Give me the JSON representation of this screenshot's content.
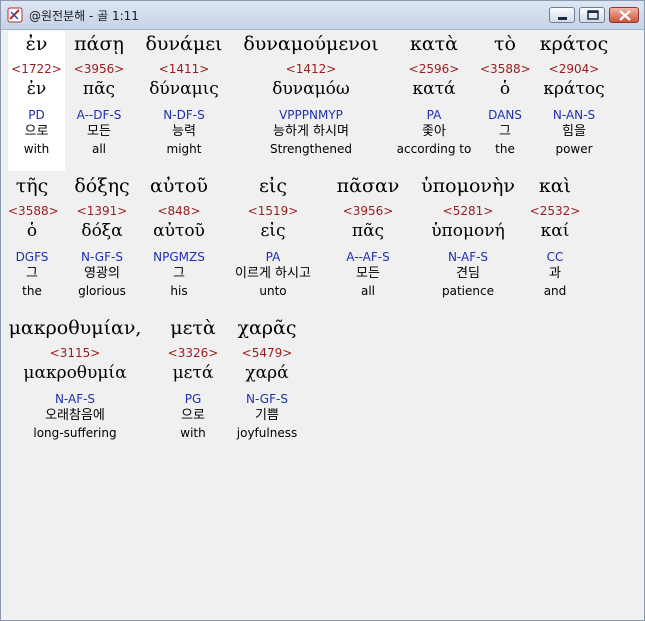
{
  "window": {
    "title": "@원전분해 - 골 1:11"
  },
  "rows": [
    [
      {
        "greek": "ἐν",
        "strong": "<1722>",
        "lemma": "ἐν",
        "morph": "PD",
        "korean": "으로",
        "english": "with"
      },
      {
        "greek": "πάσῃ",
        "strong": "<3956>",
        "lemma": "πᾶς",
        "morph": "A--DF-S",
        "korean": "모든",
        "english": "all"
      },
      {
        "greek": "δυνάμει",
        "strong": "<1411>",
        "lemma": "δύναμις",
        "morph": "N-DF-S",
        "korean": "능력",
        "english": "might"
      },
      {
        "greek": "δυναμούμενοι",
        "strong": "<1412>",
        "lemma": "δυναμόω",
        "morph": "VPPPNMYP",
        "korean": "능하게 하시며",
        "english": "Strengthened"
      },
      {
        "greek": "κατὰ",
        "strong": "<2596>",
        "lemma": "κατά",
        "morph": "PA",
        "korean": "좇아",
        "english": "according to"
      },
      {
        "greek": "τὸ",
        "strong": "<3588>",
        "lemma": "ὁ",
        "morph": "DANS",
        "korean": "그",
        "english": "the"
      },
      {
        "greek": "κράτος",
        "strong": "<2904>",
        "lemma": "κράτος",
        "morph": "N-AN-S",
        "korean": "힘을",
        "english": "power"
      }
    ],
    [
      {
        "greek": "τῆς",
        "strong": "<3588>",
        "lemma": "ὁ",
        "morph": "DGFS",
        "korean": "그",
        "english": "the"
      },
      {
        "greek": "δόξης",
        "strong": "<1391>",
        "lemma": "δόξα",
        "morph": "N-GF-S",
        "korean": "영광의",
        "english": "glorious"
      },
      {
        "greek": "αὐτοῦ",
        "strong": "<848>",
        "lemma": "αὐτοῦ",
        "morph": "NPGMZS",
        "korean": "그",
        "english": "his"
      },
      {
        "greek": "εἰς",
        "strong": "<1519>",
        "lemma": "εἰς",
        "morph": "PA",
        "korean": "이르게 하시고",
        "english": "unto"
      },
      {
        "greek": "πᾶσαν",
        "strong": "<3956>",
        "lemma": "πᾶς",
        "morph": "A--AF-S",
        "korean": "모든",
        "english": "all"
      },
      {
        "greek": "ὑπομονὴν",
        "strong": "<5281>",
        "lemma": "ὑπομονή",
        "morph": "N-AF-S",
        "korean": "견딤",
        "english": "patience"
      },
      {
        "greek": "καὶ",
        "strong": "<2532>",
        "lemma": "καί",
        "morph": "CC",
        "korean": "과",
        "english": "and"
      }
    ],
    [
      {
        "greek": "μακροθυμίαν,",
        "strong": "<3115>",
        "lemma": "μακροθυμία",
        "morph": "N-AF-S",
        "korean": "오래참음에",
        "english": "long-suffering"
      },
      {
        "greek": "μετὰ",
        "strong": "<3326>",
        "lemma": "μετά",
        "morph": "PG",
        "korean": "으로",
        "english": "with"
      },
      {
        "greek": "χαρᾶς",
        "strong": "<5479>",
        "lemma": "χαρά",
        "morph": "N-GF-S",
        "korean": "기쁨",
        "english": "joyfulness"
      }
    ]
  ]
}
